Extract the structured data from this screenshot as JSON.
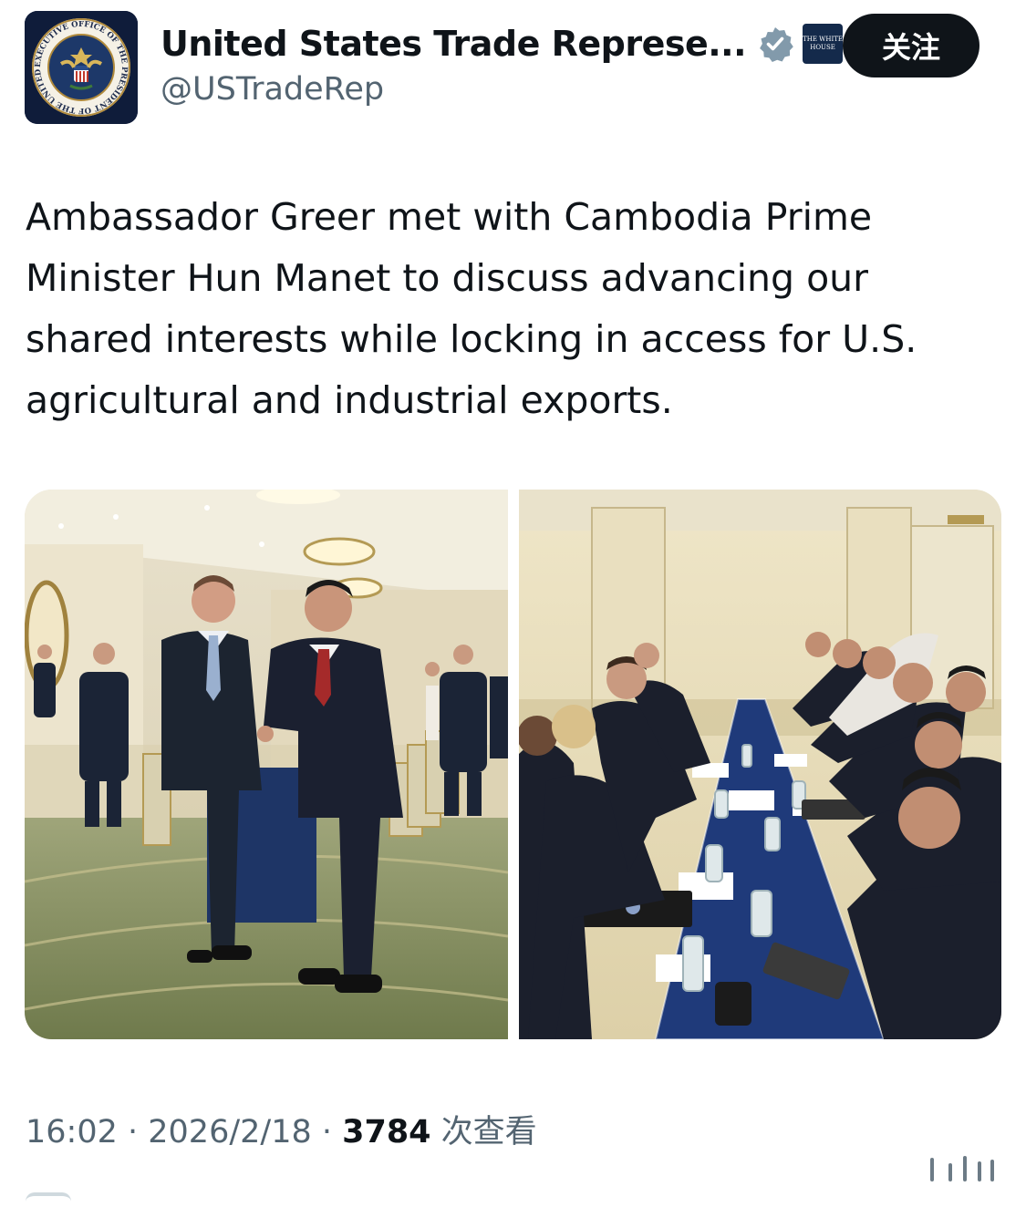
{
  "account": {
    "display_name": "United States Trade Represe...",
    "handle": "@USTradeRep",
    "avatar_icon": "presidential-seal-icon",
    "verified_icon": "verified-badge-icon",
    "affiliation_icon": "white-house-badge-icon",
    "affiliation_label": "THE WHITE HOUSE",
    "seal_text": "EXECUTIVE OFFICE OF THE PRESIDENT OF THE UNITED STATES"
  },
  "follow_button": {
    "label": "关注"
  },
  "tweet": {
    "text": "Ambassador Greer met with Cambodia Prime Minister Hun Manet to discuss advancing our shared interests while locking in access for U.S. agricultural and industrial exports."
  },
  "media": [
    {
      "name": "handshake-photo"
    },
    {
      "name": "meeting-table-photo"
    }
  ],
  "meta": {
    "time": "16:02",
    "separator": " · ",
    "date": "2026/2/18",
    "views_count": "3784",
    "views_label": " 次查看"
  },
  "colors": {
    "text": "#0f1419",
    "secondary_text": "#536471",
    "verified_badge": "#829aab",
    "button_bg": "#0f1419",
    "seal_bg": "#0f1c3a"
  }
}
